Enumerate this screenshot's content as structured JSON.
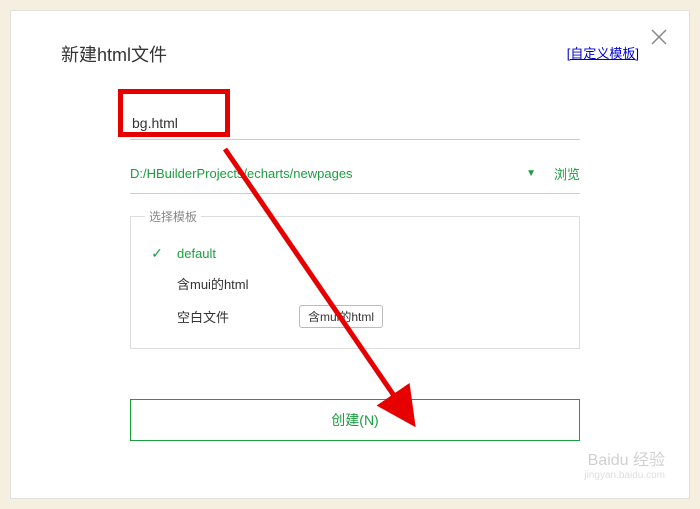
{
  "dialog": {
    "title": "新建html文件",
    "custom_template_link": "[自定义模板]"
  },
  "filename": {
    "value": "bg.html"
  },
  "path": {
    "value": "D:/HBuilderProjects/echarts/newpages",
    "browse_label": "浏览"
  },
  "templates": {
    "legend": "选择模板",
    "items": [
      {
        "label": "default",
        "selected": true
      },
      {
        "label": "含mui的html",
        "selected": false
      },
      {
        "label": "空白文件",
        "selected": false
      }
    ],
    "tooltip": "含mui的html"
  },
  "actions": {
    "create_label": "创建(N)"
  },
  "watermark": {
    "brand": "Baidu 经验",
    "url": "jingyan.baidu.com"
  }
}
